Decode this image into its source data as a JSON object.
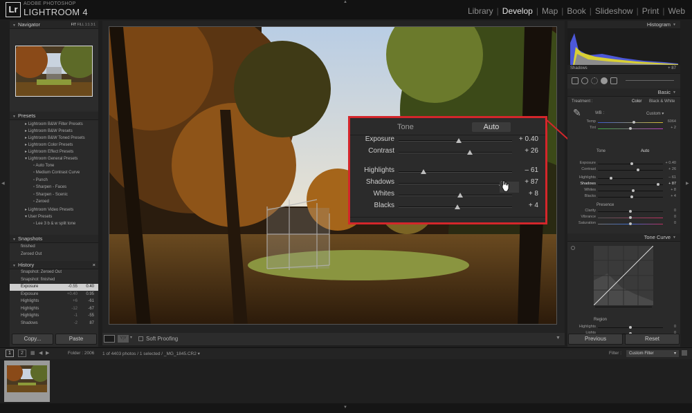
{
  "app": {
    "brand_small": "ADOBE PHOTOSHOP",
    "brand_big": "LIGHTROOM 4",
    "logo": "Lr"
  },
  "modules": [
    "Library",
    "Develop",
    "Map",
    "Book",
    "Slideshow",
    "Print",
    "Web"
  ],
  "active_module": "Develop",
  "left": {
    "navigator": {
      "title": "Navigator",
      "zoom_options": [
        "FIT",
        "FILL",
        "1:1",
        "3:1"
      ]
    },
    "presets": {
      "title": "Presets",
      "items": [
        "Lightroom B&W Filter Presets",
        "Lightroom B&W Presets",
        "Lightroom B&W Toned Presets",
        "Lightroom Color Presets",
        "Lightroom Effect Presets",
        "Lightroom General Presets"
      ],
      "sub_items": [
        "Auto Tone",
        "Medium Contrast Curve",
        "Punch",
        "Sharpen - Faces",
        "Sharpen - Scenic",
        "Zeroed"
      ],
      "items2": [
        "Lightroom Video Presets",
        "User Presets"
      ],
      "user_items": [
        "Lee 3 b & w split tone"
      ]
    },
    "snapshots": {
      "title": "Snapshots",
      "items": [
        "finished",
        "Zeroed Out"
      ]
    },
    "history": {
      "title": "History",
      "close": "×",
      "items": [
        {
          "name": "Snapshot: Zeroed Out",
          "a": "",
          "b": ""
        },
        {
          "name": "Snapshot: finished",
          "a": "",
          "b": ""
        },
        {
          "name": "Exposure",
          "a": "-0.55",
          "b": "0.40"
        },
        {
          "name": "Exposure",
          "a": "+0.40",
          "b": "0.95"
        },
        {
          "name": "Highlights",
          "a": "+6",
          "b": "-61"
        },
        {
          "name": "Highlights",
          "a": "-12",
          "b": "-67"
        },
        {
          "name": "Highlights",
          "a": "-1",
          "b": "-55"
        },
        {
          "name": "Shadows",
          "a": "-2",
          "b": "87"
        }
      ]
    },
    "copy_label": "Copy...",
    "paste_label": "Paste"
  },
  "toolbar": {
    "soft_proofing": "Soft Proofing"
  },
  "zoom_panel": {
    "tone_label": "Tone",
    "auto_label": "Auto",
    "sliders": [
      {
        "name": "Exposure",
        "value": "+ 0.40",
        "pos": 0.53
      },
      {
        "name": "Contrast",
        "value": "+ 26",
        "pos": 0.63
      },
      {
        "name": "Highlights",
        "value": "– 61",
        "pos": 0.22
      },
      {
        "name": "Shadows",
        "value": "+ 87",
        "pos": 0.91
      },
      {
        "name": "Whites",
        "value": "+ 8",
        "pos": 0.54
      },
      {
        "name": "Blacks",
        "value": "+ 4",
        "pos": 0.52
      }
    ]
  },
  "right": {
    "histogram": {
      "title": "Histogram",
      "shadows_label": "Shadows",
      "shadows_value": "+ 87"
    },
    "basic": {
      "title": "Basic",
      "treatment_label": "Treatment :",
      "color_label": "Color",
      "bw_label": "Black & White",
      "wb_label": "WB :",
      "wb_value": "Custom",
      "temp": {
        "label": "Temp",
        "value": "6064",
        "pos": 0.55
      },
      "tint": {
        "label": "Tint",
        "value": "+ 2",
        "pos": 0.5
      },
      "tone_label": "Tone",
      "auto_label": "Auto",
      "sliders": [
        {
          "label": "Exposure",
          "value": "+ 0.40",
          "pos": 0.52
        },
        {
          "label": "Contrast",
          "value": "+ 26",
          "pos": 0.62
        },
        {
          "label": "Highlights",
          "value": "– 61",
          "pos": 0.2
        },
        {
          "label": "Shadows",
          "value": "+ 87",
          "pos": 0.93
        },
        {
          "label": "Whites",
          "value": "+ 8",
          "pos": 0.54
        },
        {
          "label": "Blacks",
          "value": "+ 4",
          "pos": 0.52
        }
      ],
      "presence_label": "Presence",
      "presence": [
        {
          "label": "Clarity",
          "value": "0",
          "pos": 0.5
        },
        {
          "label": "Vibrance",
          "value": "0",
          "pos": 0.5
        },
        {
          "label": "Saturation",
          "value": "0",
          "pos": 0.5
        }
      ]
    },
    "tone_curve": {
      "title": "Tone Curve",
      "region_label": "Region",
      "sliders": [
        {
          "label": "Highlights",
          "value": "0"
        },
        {
          "label": "Lights",
          "value": "0"
        }
      ]
    },
    "previous_label": "Previous",
    "reset_label": "Reset"
  },
  "filmbar": {
    "page1": "1",
    "page2": "2",
    "folder": "Folder : 2006",
    "count": "1 of 4403 photos / 1 selected / _MG_1845.CR2 ▾",
    "filter_label": "Filter :",
    "filter_value": "Custom Filter"
  },
  "colors": {
    "accent_red": "#d4262b",
    "panel": "#2a2a2a",
    "bar": "#121212"
  }
}
